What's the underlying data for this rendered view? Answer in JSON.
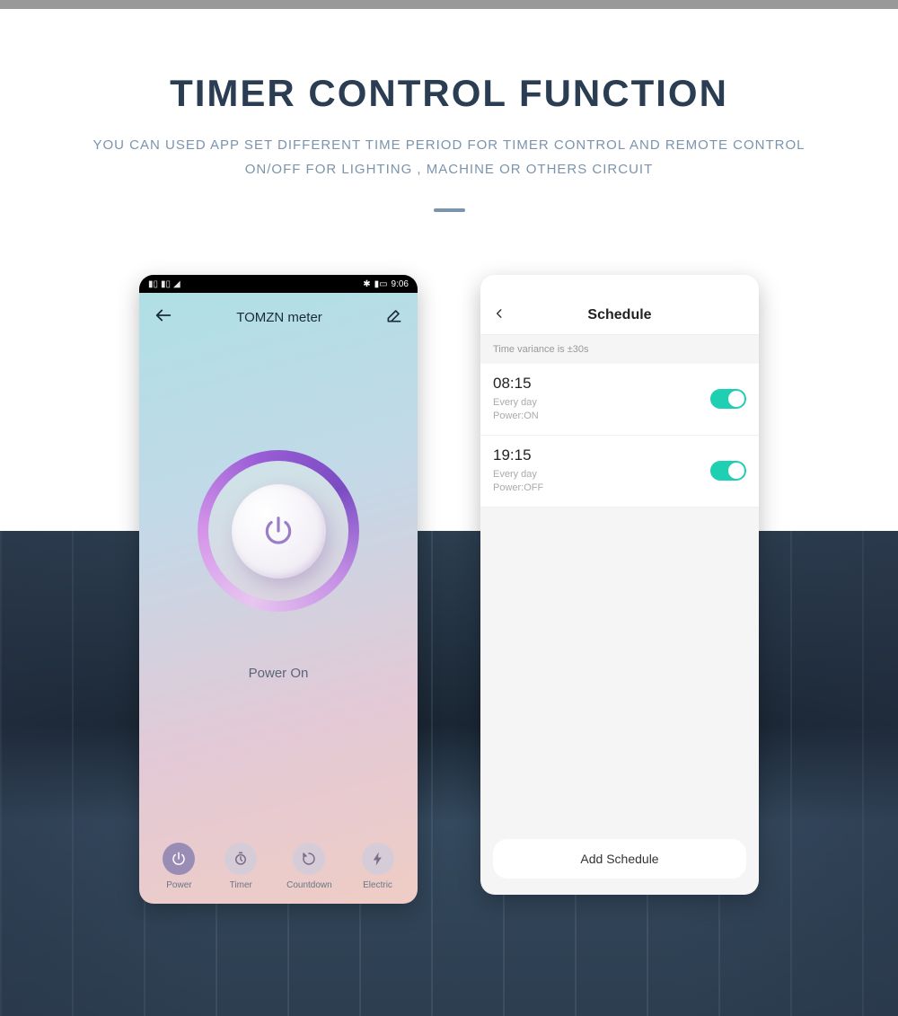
{
  "header": {
    "title": "TIMER CONTROL FUNCTION",
    "subtitle": "YOU CAN USED APP SET DIFFERENT TIME PERIOD FOR TIMER CONTROL AND REMOTE CONTROL ON/OFF FOR LIGHTING , MACHINE OR OTHERS CIRCUIT"
  },
  "phone1": {
    "status_time": "9:06",
    "app_title": "TOMZN meter",
    "power_status": "Power On",
    "nav": [
      {
        "label": "Power"
      },
      {
        "label": "Timer"
      },
      {
        "label": "Countdown"
      },
      {
        "label": "Electric"
      }
    ]
  },
  "phone2": {
    "title": "Schedule",
    "variance": "Time variance is ±30s",
    "items": [
      {
        "time": "08:15",
        "repeat": "Every day",
        "action": "Power:ON"
      },
      {
        "time": "19:15",
        "repeat": "Every day",
        "action": "Power:OFF"
      }
    ],
    "add_button": "Add Schedule"
  }
}
